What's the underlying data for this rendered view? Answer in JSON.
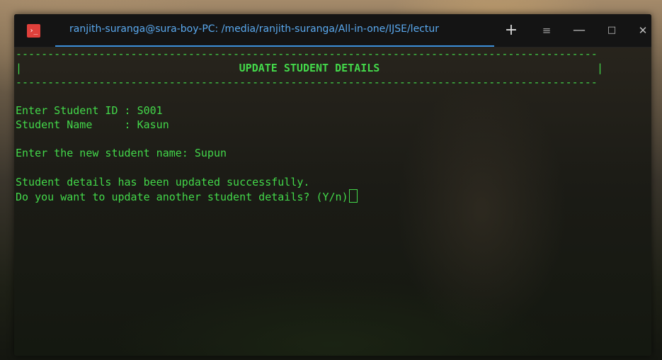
{
  "window": {
    "tab_title": "ranjith-suranga@sura-boy-PC: /media/ranjith-suranga/All-in-one/IJSE/lectur",
    "app_icon_glyph": "›_",
    "controls": {
      "new_tab": "+",
      "menu": "≡",
      "minimize": "—",
      "maximize": "□",
      "close": "✕"
    },
    "accent_color": "#3d8fd8",
    "icon_color": "#e0403b"
  },
  "terminal": {
    "text_color": "#43d84a",
    "separator_top": "-------------------------------------------------------------------------------------------",
    "heading_left_bar": "|",
    "heading_title": "UPDATE STUDENT DETAILS",
    "heading_right_bar": "|",
    "separator_bottom": "-------------------------------------------------------------------------------------------",
    "lines": [
      "Enter Student ID : S001",
      "Student Name     : Kasun",
      "Enter the new student name: Supun",
      "Student details has been updated successfully.",
      "Do you want to update another student details? (Y/n)"
    ]
  }
}
